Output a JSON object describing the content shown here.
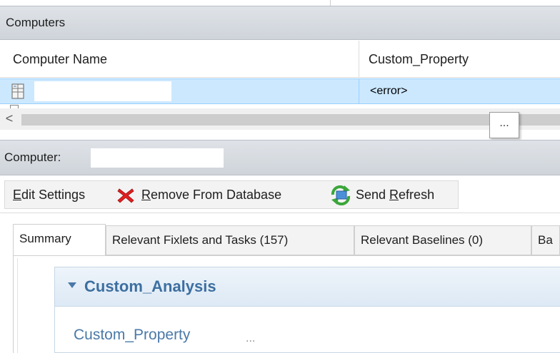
{
  "computers_panel": {
    "title": "Computers",
    "columns": [
      "Computer Name",
      "Custom_Property"
    ],
    "rows": [
      {
        "name": "",
        "custom_property": "<error>"
      }
    ]
  },
  "scrollbar": {
    "left_arrow": "<"
  },
  "ellipsis_box": {
    "text": "..."
  },
  "computer_panel": {
    "label": "Computer:",
    "name": ""
  },
  "toolbar": {
    "edit_settings": {
      "prefix": "",
      "mnemonic": "E",
      "rest": "dit Settings"
    },
    "remove_from_database": {
      "prefix": "",
      "mnemonic": "R",
      "rest": "emove From Database",
      "icon": "red-x-icon"
    },
    "send_refresh": {
      "prefix": "Send ",
      "mnemonic": "R",
      "rest": "efresh",
      "icon": "refresh-computer-icon"
    }
  },
  "tabs": [
    {
      "label": "Summary",
      "active": true
    },
    {
      "label": "Relevant Fixlets and Tasks (157)",
      "active": false
    },
    {
      "label": "Relevant Baselines (0)",
      "active": false
    },
    {
      "label": "Ba",
      "active": false
    }
  ],
  "analysis": {
    "title": "Custom_Analysis",
    "property_label": "Custom_Property",
    "property_value": "..."
  },
  "colors": {
    "selection": "#cce8ff",
    "analysis_title": "#3d6fa0",
    "remove_icon": "#e02020"
  }
}
